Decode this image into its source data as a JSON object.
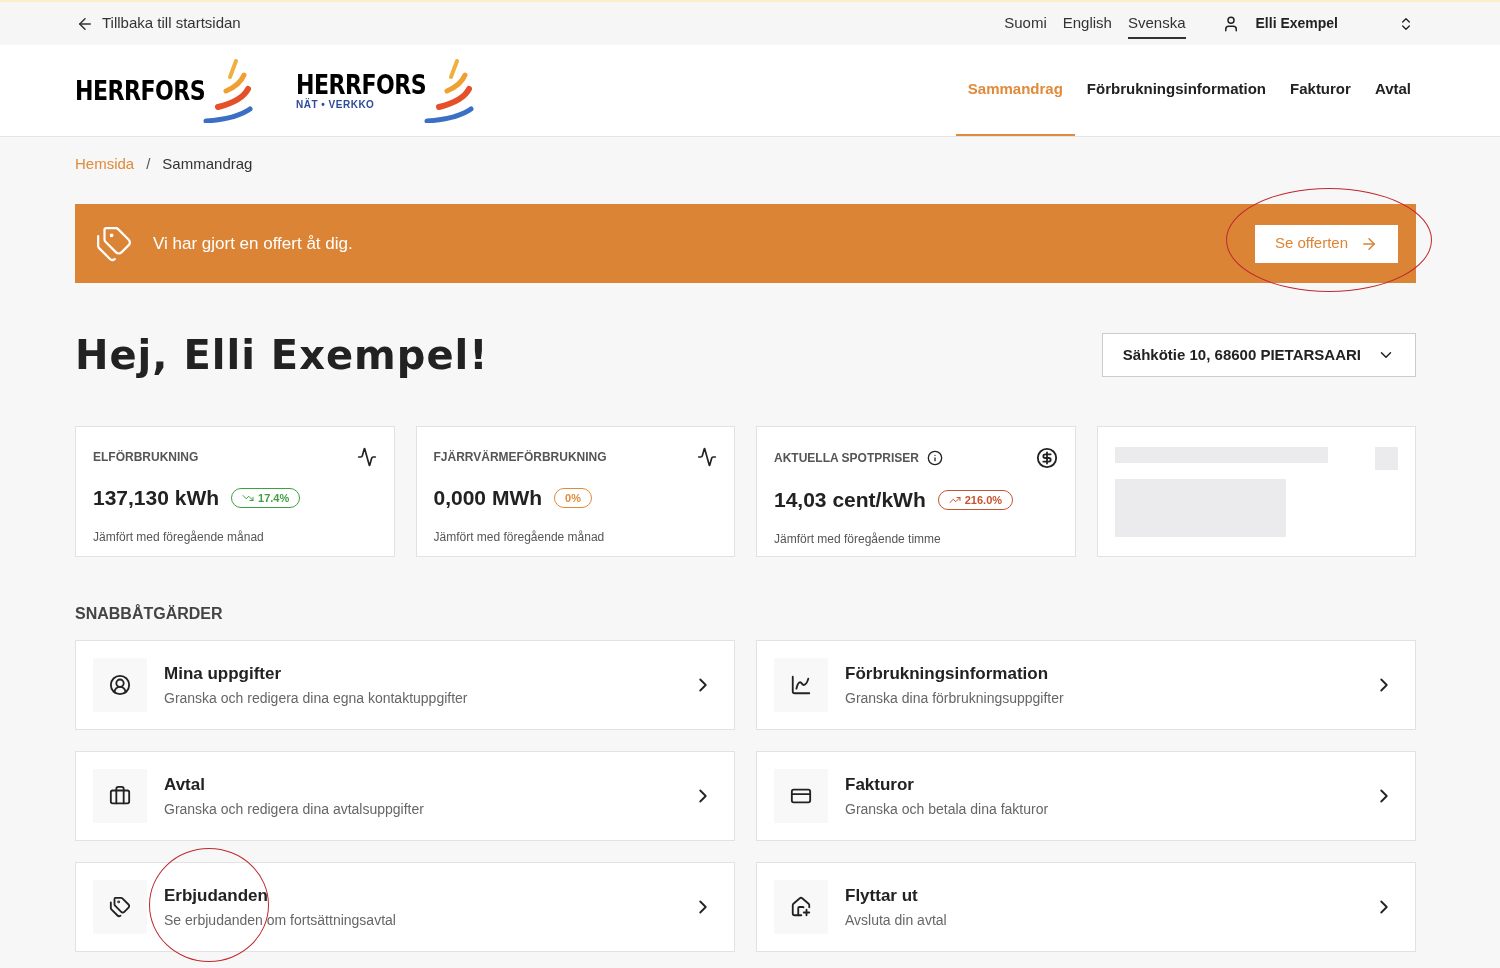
{
  "topbar": {
    "back_link": "Tillbaka till startsidan",
    "languages": [
      {
        "label": "Suomi",
        "selected": false
      },
      {
        "label": "English",
        "selected": false
      },
      {
        "label": "Svenska",
        "selected": true
      }
    ],
    "user": "Elli Exempel"
  },
  "logos": [
    {
      "name": "HERRFORS"
    },
    {
      "name": "HERRFORS",
      "sub": "NÄT • VERKKO"
    }
  ],
  "nav": [
    {
      "label": "Sammandrag",
      "selected": true
    },
    {
      "label": "Förbrukningsinformation",
      "selected": false
    },
    {
      "label": "Fakturor",
      "selected": false
    },
    {
      "label": "Avtal",
      "selected": false
    }
  ],
  "breadcrumb": {
    "items": [
      "Hemsida",
      "Sammandrag"
    ],
    "separator": "/"
  },
  "offer_banner": {
    "text": "Vi har gjort en offert åt dig.",
    "button": "Se offerten",
    "circled": true
  },
  "greeting": "Hej, Elli Exempel!",
  "address_select": "Sähkötie 10, 68600 PIETARSAARI",
  "metrics": [
    {
      "kind": "consumption",
      "title": "ELFÖRBRUKNING",
      "info": false,
      "value": "137,130 kWh",
      "change": {
        "kind": "down",
        "text": "17.4%",
        "color": "#3f9f43"
      },
      "note": "Jämfört med föregående månad"
    },
    {
      "kind": "consumption",
      "title": "FJÄRRVÄRMEFÖRBRUKNING",
      "info": false,
      "value": "0,000 MWh",
      "change": {
        "kind": "flat",
        "text": "0%",
        "color": "#e08a3a"
      },
      "note": "Jämfört med föregående månad"
    },
    {
      "kind": "price",
      "title": "AKTUELLA SPOTPRISER",
      "info": true,
      "value": "14,03 cent/kWh",
      "change": {
        "kind": "up",
        "text": "216.0%",
        "color": "#c8522f"
      },
      "note": "Jämfört med föregående timme"
    }
  ],
  "quick_actions_title": "SNABBÅTGÄRDER",
  "quick_actions": [
    {
      "kind": "profile",
      "title": "Mina uppgifter",
      "text": "Granska och redigera dina egna kontaktuppgifter",
      "circled": false
    },
    {
      "kind": "consumption",
      "title": "Förbrukningsinformation",
      "text": "Granska dina förbrukningsuppgifter",
      "circled": false
    },
    {
      "kind": "contract",
      "title": "Avtal",
      "text": "Granska och redigera dina avtalsuppgifter",
      "circled": false
    },
    {
      "kind": "invoice",
      "title": "Fakturor",
      "text": "Granska och betala dina fakturor",
      "circled": false
    },
    {
      "kind": "offer",
      "title": "Erbjudanden",
      "text": "Se erbjudanden om fortsättningsavtal",
      "circled": true
    },
    {
      "kind": "move",
      "title": "Flyttar ut",
      "text": "Avsluta din avtal",
      "circled": false
    }
  ]
}
